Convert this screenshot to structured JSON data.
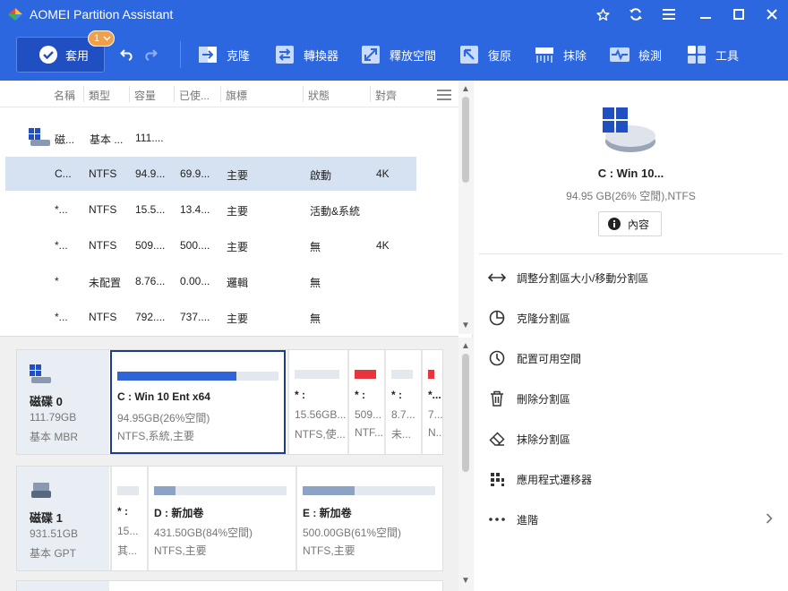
{
  "app": {
    "title": "AOMEI Partition Assistant"
  },
  "toolbar": {
    "apply_label": "套用",
    "pending_count": "1",
    "tools": [
      "克隆",
      "轉換器",
      "釋放空間",
      "復原",
      "抹除",
      "檢測",
      "工具"
    ]
  },
  "columns": [
    "名稱",
    "類型",
    "容量",
    "已使...",
    "旗標",
    "狀態",
    "對齊"
  ],
  "disk_row": {
    "name": "磁...",
    "type": "基本 ...",
    "capacity": "111...."
  },
  "partitions": [
    {
      "name": "C...",
      "type": "NTFS",
      "capacity": "94.9...",
      "used": "69.9...",
      "flag": "主要",
      "status": "啟動",
      "align": "4K"
    },
    {
      "name": "*...",
      "type": "NTFS",
      "capacity": "15.5...",
      "used": "13.4...",
      "flag": "主要",
      "status": "活動&系統",
      "align": ""
    },
    {
      "name": "*...",
      "type": "NTFS",
      "capacity": "509....",
      "used": "500....",
      "flag": "主要",
      "status": "無",
      "align": "4K"
    },
    {
      "name": "*",
      "type": "未配置",
      "capacity": "8.76...",
      "used": "0.00...",
      "flag": "邏輯",
      "status": "無",
      "align": ""
    },
    {
      "name": "*...",
      "type": "NTFS",
      "capacity": "792....",
      "used": "737....",
      "flag": "主要",
      "status": "無",
      "align": ""
    }
  ],
  "disks": [
    {
      "name": "磁碟 0",
      "size": "111.79GB",
      "type": "基本 MBR",
      "parts": [
        {
          "name": "C : Win 10 Ent x64",
          "size": "94.95GB(26%空間)",
          "fs": "NTFS,系統,主要",
          "used_pct": 74
        },
        {
          "name": "* :",
          "size": "15.56GB...",
          "fs": "NTFS,使..."
        },
        {
          "name": "* :",
          "size": "509...",
          "fs": "NTF..."
        },
        {
          "name": "* :",
          "size": "8.7...",
          "fs": "未..."
        },
        {
          "name": "*...",
          "size": "7...",
          "fs": "N..."
        }
      ]
    },
    {
      "name": "磁碟 1",
      "size": "931.51GB",
      "type": "基本 GPT",
      "parts": [
        {
          "name": "* :",
          "size": "15...",
          "fs": "其..."
        },
        {
          "name": "D : 新加卷",
          "size": "431.50GB(84%空間)",
          "fs": "NTFS,主要",
          "used_pct": 16
        },
        {
          "name": "E : 新加卷",
          "size": "500.00GB(61%空間)",
          "fs": "NTFS,主要",
          "used_pct": 39
        }
      ]
    }
  ],
  "details": {
    "title": "C : Win 10...",
    "subtitle": "94.95 GB(26% 空閒),NTFS",
    "properties_label": "內容"
  },
  "operations": [
    "調整分割區大小/移動分割區",
    "克隆分割區",
    "配置可用空間",
    "刪除分割區",
    "抹除分割區",
    "應用程式遷移器",
    "進階"
  ],
  "colors": {
    "accent": "#2c67e0",
    "selection": "#d6e2f2",
    "used_bar": "#2f63d8",
    "red_bar": "#e8343c",
    "gray_bar": "#8da3c4"
  }
}
